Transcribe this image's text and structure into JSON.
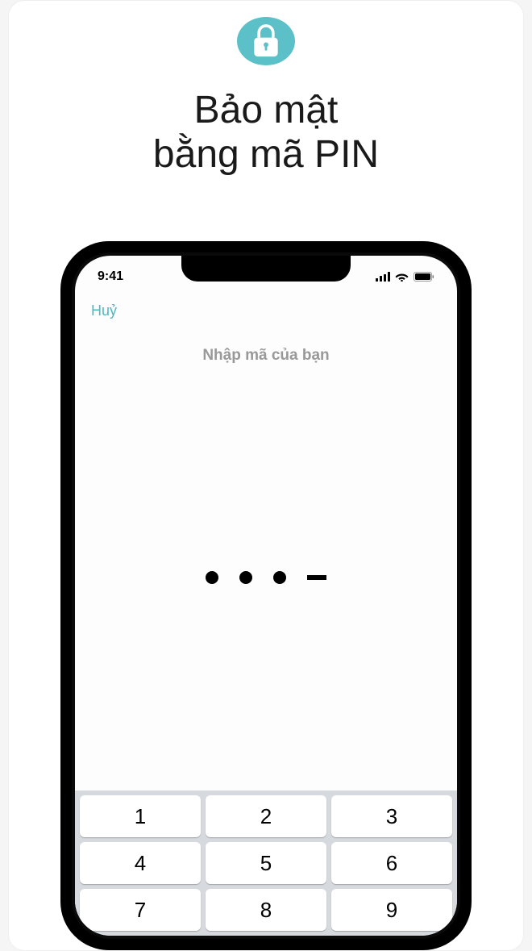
{
  "promo": {
    "title_line1": "Bảo mật",
    "title_line2": "bằng mã PIN"
  },
  "status_bar": {
    "time": "9:41"
  },
  "nav": {
    "cancel": "Huỷ"
  },
  "prompt": {
    "text": "Nhập mã của bạn"
  },
  "pin": {
    "entered_count": 3,
    "total": 4
  },
  "keypad": {
    "rows": [
      [
        "1",
        "2",
        "3"
      ],
      [
        "4",
        "5",
        "6"
      ],
      [
        "7",
        "8",
        "9"
      ]
    ]
  }
}
